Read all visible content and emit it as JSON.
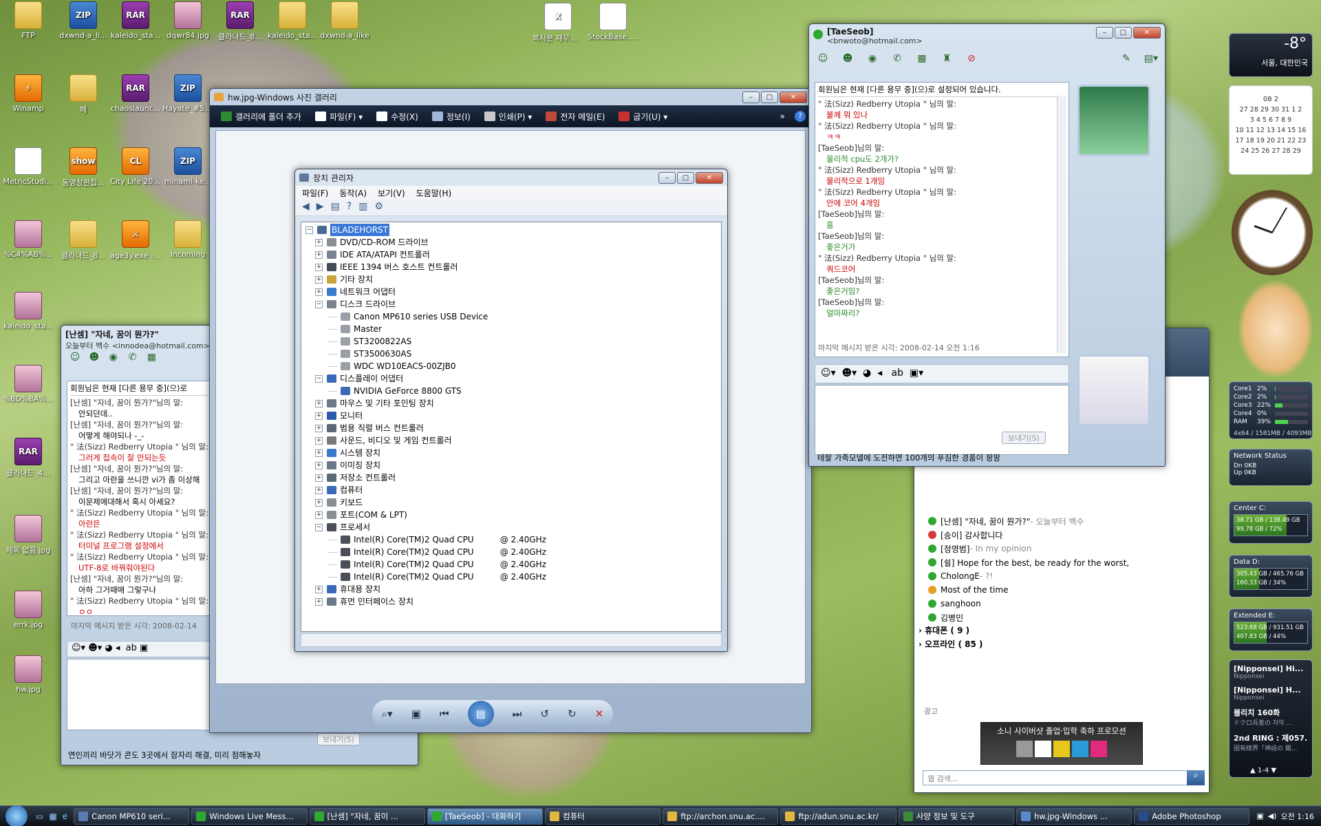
{
  "desktop_icons": [
    {
      "label": "FTP",
      "kind": "folder",
      "badge": ""
    },
    {
      "label": "dxwnd-a_li...",
      "kind": "zip",
      "badge": "ZIP"
    },
    {
      "label": "kaleido_sta...",
      "kind": "rar",
      "badge": "RAR"
    },
    {
      "label": "dqwr84.jpg",
      "kind": "img",
      "badge": ""
    },
    {
      "label": "클라나드_8...",
      "kind": "rar",
      "badge": "RAR"
    },
    {
      "label": "kaleido_sta...",
      "kind": "folder",
      "badge": ""
    },
    {
      "label": "dxwnd-a_like",
      "kind": "folder",
      "badge": ""
    },
    {
      "label": "복사본 재무제...",
      "kind": "doc",
      "badge": "X"
    },
    {
      "label": "StockBase.zip",
      "kind": "doc",
      "badge": ""
    },
    {
      "label": "Winamp",
      "kind": "app",
      "badge": "⚡"
    },
    {
      "label": "메",
      "kind": "folder",
      "badge": ""
    },
    {
      "label": "chaoslaunc...",
      "kind": "rar",
      "badge": "RAR"
    },
    {
      "label": "Hayate_#5_...",
      "kind": "zip",
      "badge": "ZIP"
    },
    {
      "label": "MetricStudi...",
      "kind": "doc",
      "badge": ""
    },
    {
      "label": "동영상편집...",
      "kind": "app",
      "badge": "show"
    },
    {
      "label": "City Life 2008",
      "kind": "app",
      "badge": "CL"
    },
    {
      "label": "minami-ke...",
      "kind": "zip",
      "badge": "ZIP"
    },
    {
      "label": "%C4%AB%...",
      "kind": "img",
      "badge": ""
    },
    {
      "label": "클라나드_8...",
      "kind": "folder",
      "badge": ""
    },
    {
      "label": "age3y.exe - 바로 가기",
      "kind": "app",
      "badge": "⚔"
    },
    {
      "label": "Incoming",
      "kind": "folder",
      "badge": ""
    },
    {
      "label": "kaleido_sta...",
      "kind": "img",
      "badge": ""
    },
    {
      "label": "%BD%BA%...",
      "kind": "img",
      "badge": ""
    },
    {
      "label": "클라나드_4...",
      "kind": "rar",
      "badge": "RAR"
    },
    {
      "label": "제목 없음.jpg",
      "kind": "img",
      "badge": ""
    },
    {
      "label": "errk.jpg",
      "kind": "img",
      "badge": ""
    },
    {
      "label": "hw.jpg",
      "kind": "img",
      "badge": ""
    }
  ],
  "msgr_main": {
    "title": "[TaeSeob]",
    "email": "<bnwoto@hotmail.com>",
    "status_notice": "회원님은 현재 [다른 용무 중](으)로 설정되어 있습니다.",
    "conversation": [
      {
        "who": "\" 法(Sizz) Redberry Utopia \" 님의 말:",
        "text": "볼께 뭐 있나",
        "c": "t1"
      },
      {
        "who": "\" 法(Sizz) Redberry Utopia \" 님의 말:",
        "text": "ㅋㅋ",
        "c": "t1"
      },
      {
        "who": "[TaeSeob]님의 말:",
        "text": "물리적 cpu도 2개가?",
        "c": "t2"
      },
      {
        "who": "\" 法(Sizz) Redberry Utopia \" 님의 말:",
        "text": "물리적으로 1개임",
        "c": "t1"
      },
      {
        "who": "\" 法(Sizz) Redberry Utopia \" 님의 말:",
        "text": "안에 코어 4개임",
        "c": "t1"
      },
      {
        "who": "[TaeSeob]님의 말:",
        "text": "흠",
        "c": "t2"
      },
      {
        "who": "[TaeSeob]님의 말:",
        "text": "좋은거가",
        "c": "t2"
      },
      {
        "who": "\" 法(Sizz) Redberry Utopia \" 님의 말:",
        "text": "쿼드코어",
        "c": "t1"
      },
      {
        "who": "[TaeSeob]님의 말:",
        "text": "좋은거임?",
        "c": "t2"
      },
      {
        "who": "[TaeSeob]님의 말:",
        "text": "얼마짜리?",
        "c": "t2"
      }
    ],
    "last_received": "마지막 메시지 받은 시각: 2008-02-14 오전 1:16",
    "send_label": "보내기(S)",
    "ad": "테팔 가족모델에 도전하면 100개의 푸짐한 경품이 팡팡"
  },
  "msgr_left": {
    "title": "[난셈] \"자네, 꿈이 뭔가?\"",
    "email": "오늘부터 백수 <innodea@hotmail.com>",
    "status_notice": "회원님은 현재 [다른 용무 중](으)로",
    "conversation": [
      {
        "who": "[난셈] \"자네, 꿈이 뭔가?\"님의 말:",
        "text": "안되던데..",
        "c": "t3"
      },
      {
        "who": "[난셈] \"자네, 꿈이 뭔가?\"님의 말:",
        "text": "어떻게 해야되나 -_-",
        "c": "t3"
      },
      {
        "who": "\" 法(Sizz) Redberry Utopia \" 님의 말:",
        "text": "그러게 접속이 잘 안되는듯",
        "c": "t1"
      },
      {
        "who": "[난셈] \"자네, 꿈이 뭔가?\"님의 말:",
        "text": "그리고 아란을 쓰니깐 vi가 좀 이상해",
        "c": "t3"
      },
      {
        "who": "[난셈] \"자네, 꿈이 뭔가?\"님의 말:",
        "text": "이문제에대해서 혹시 아세요?",
        "c": "t3"
      },
      {
        "who": "\" 法(Sizz) Redberry Utopia \" 님의 말:",
        "text": "아란은",
        "c": "t1"
      },
      {
        "who": "\" 法(Sizz) Redberry Utopia \" 님의 말:",
        "text": "터미널 프로그램 설정에서",
        "c": "t1"
      },
      {
        "who": "\" 法(Sizz) Redberry Utopia \" 님의 말:",
        "text": "UTF-8로 바꿔줘야된다",
        "c": "t1"
      },
      {
        "who": "[난셈] \"자네, 꿈이 뭔가?\"님의 말:",
        "text": "아하 그거때매 그렇구나",
        "c": "t3"
      },
      {
        "who": "\" 法(Sizz) Redberry Utopia \" 님의 말:",
        "text": "ㅇㅇ",
        "c": "t1"
      }
    ],
    "last_received": "마지막 메시지 받은 시각: 2008-02-14",
    "send_label": "보내기(S)",
    "ad": "연인끼리 바닷가 콘도 3곳에서 잠자리 해결, 미리 점해놓자"
  },
  "gallery": {
    "title": "hw.jpg-Windows 사진 갤러리",
    "toolbar": [
      "갤러리에 폴더 추가",
      "파일(F)",
      "수정(X)",
      "정보(I)",
      "인쇄(P)",
      "전자 메일(E)",
      "굽기(U)"
    ]
  },
  "devmgr": {
    "title": "장치 관리자",
    "menu": [
      "파일(F)",
      "동작(A)",
      "보기(V)",
      "도움말(H)"
    ],
    "root": "BLADEHORST",
    "nodes": [
      {
        "label": "DVD/CD-ROM 드라이브",
        "level": 1,
        "exp": "+",
        "ic": "#8a8f96"
      },
      {
        "label": "IDE ATA/ATAPI 컨트롤러",
        "level": 1,
        "exp": "+",
        "ic": "#7a8494"
      },
      {
        "label": "IEEE 1394 버스 호스트 컨트롤러",
        "level": 1,
        "exp": "+",
        "ic": "#444c58"
      },
      {
        "label": "기타 장치",
        "level": 1,
        "exp": "+",
        "ic": "#c8a43a"
      },
      {
        "label": "네트워크 어댑터",
        "level": 1,
        "exp": "+",
        "ic": "#3a7ac8"
      },
      {
        "label": "디스크 드라이브",
        "level": 1,
        "exp": "−",
        "ic": "#7c8490"
      },
      {
        "label": "Canon MP610 series USB Device",
        "level": 2,
        "exp": "",
        "ic": "#9aa0a8"
      },
      {
        "label": "Master",
        "level": 2,
        "exp": "",
        "ic": "#9aa0a8"
      },
      {
        "label": "ST3200822AS",
        "level": 2,
        "exp": "",
        "ic": "#9aa0a8"
      },
      {
        "label": "ST3500630AS",
        "level": 2,
        "exp": "",
        "ic": "#9aa0a8"
      },
      {
        "label": "WDC WD10EACS-00ZJB0",
        "level": 2,
        "exp": "",
        "ic": "#9aa0a8"
      },
      {
        "label": "디스플레이 어댑터",
        "level": 1,
        "exp": "−",
        "ic": "#3a6ab8"
      },
      {
        "label": "NVIDIA GeForce 8800 GTS",
        "level": 2,
        "exp": "",
        "ic": "#3a6ab8"
      },
      {
        "label": "마우스 및 기타 포인팅 장치",
        "level": 1,
        "exp": "+",
        "ic": "#6a7888"
      },
      {
        "label": "모니터",
        "level": 1,
        "exp": "+",
        "ic": "#2a5ab0"
      },
      {
        "label": "범용 직렬 버스 컨트롤러",
        "level": 1,
        "exp": "+",
        "ic": "#5a6878"
      },
      {
        "label": "사운드, 비디오 및 게임 컨트롤러",
        "level": 1,
        "exp": "+",
        "ic": "#7a7a7a"
      },
      {
        "label": "시스템 장치",
        "level": 1,
        "exp": "+",
        "ic": "#3a7ac8"
      },
      {
        "label": "이미징 장치",
        "level": 1,
        "exp": "+",
        "ic": "#6a7888"
      },
      {
        "label": "저장소 컨트롤러",
        "level": 1,
        "exp": "+",
        "ic": "#5a6878"
      },
      {
        "label": "컴퓨터",
        "level": 1,
        "exp": "+",
        "ic": "#3a6ab8"
      },
      {
        "label": "키보드",
        "level": 1,
        "exp": "+",
        "ic": "#8a8f96"
      },
      {
        "label": "포트(COM & LPT)",
        "level": 1,
        "exp": "+",
        "ic": "#8a8f96"
      },
      {
        "label": "프로세서",
        "level": 1,
        "exp": "−",
        "ic": "#4a4f58"
      },
      {
        "label": "Intel(R) Core(TM)2 Quad CPU          @ 2.40GHz",
        "level": 2,
        "exp": "",
        "ic": "#4a4f58"
      },
      {
        "label": "Intel(R) Core(TM)2 Quad CPU          @ 2.40GHz",
        "level": 2,
        "exp": "",
        "ic": "#4a4f58"
      },
      {
        "label": "Intel(R) Core(TM)2 Quad CPU          @ 2.40GHz",
        "level": 2,
        "exp": "",
        "ic": "#4a4f58"
      },
      {
        "label": "Intel(R) Core(TM)2 Quad CPU          @ 2.40GHz",
        "level": 2,
        "exp": "",
        "ic": "#4a4f58"
      },
      {
        "label": "휴대용 장치",
        "level": 1,
        "exp": "+",
        "ic": "#3a6ab8"
      },
      {
        "label": "휴먼 인터페이스 장치",
        "level": 1,
        "exp": "+",
        "ic": "#6a7888"
      }
    ]
  },
  "contacts": {
    "items": [
      {
        "label": "[난셈] \"자네, 꿈이 뭔가?\"",
        "sub": " - 오늘부터 백수",
        "status": "#2fa82f"
      },
      {
        "label": "[송이] 감사합니다",
        "sub": "",
        "status": "#d03a3a"
      },
      {
        "label": "[정영범]",
        "sub": " - In my opinion",
        "status": "#2fa82f"
      },
      {
        "label": "[쉴] Hope for the best, be ready for the worst,",
        "sub": "",
        "status": "#2fa82f"
      },
      {
        "label": "CholongE",
        "sub": " - ?!",
        "status": "#2fa82f"
      },
      {
        "label": "Most of the time",
        "sub": "",
        "status": "#e6a020"
      },
      {
        "label": "sanghoon",
        "sub": "",
        "status": "#2fa82f"
      },
      {
        "label": "김병민",
        "sub": "",
        "status": "#2fa82f"
      }
    ],
    "groups": [
      "휴대폰 ( 9 )",
      "오프라인 ( 85 )"
    ],
    "ad_label": "광고",
    "banner": "소니 사이버샷 졸업·입학 축하 프로모션",
    "search_placeholder": "웹 검색..."
  },
  "gadgets": {
    "weather_temp": "-8°",
    "weather_city": "서울, 대한민국",
    "calendar_title": "08 2",
    "calendar_rows": [
      "27 28 29 30 31 1 2",
      "3 4 5 6 7 8 9",
      "10 11 12 13 14 15 16",
      "17 18 19 20 21 22 23",
      "24 25 26 27 28 29"
    ],
    "cpu": [
      {
        "name": "Core1",
        "val": "2%",
        "fill": 0.02
      },
      {
        "name": "Core2",
        "val": "2%",
        "fill": 0.02
      },
      {
        "name": "Core3",
        "val": "22%",
        "fill": 0.22
      },
      {
        "name": "Core4",
        "val": "0%",
        "fill": 0
      },
      {
        "name": "RAM",
        "val": "39%",
        "fill": 0.39
      }
    ],
    "ram_detail": "4x64 / 1581MB / 4093MB",
    "network_title": "Network Status",
    "net_dn": "Dn  0KB",
    "net_up": "Up  0KB",
    "drives": [
      {
        "name": "Center C:",
        "a": "38.71 GB / 138.49 GB",
        "b": "99.78 GB / 72%",
        "fill": 0.72
      },
      {
        "name": "Data D:",
        "a": "305.43 GB / 465.76 GB",
        "b": "160.33 GB / 34%",
        "fill": 0.34
      },
      {
        "name": "Extended E:",
        "a": "523.68 GB / 931.51 GB",
        "b": "407.83 GB / 44%",
        "fill": 0.44
      }
    ],
    "feed": [
      {
        "t": "[Nipponsei] Hi...",
        "s": "Nipponsei"
      },
      {
        "t": "[Nipponsei] H...",
        "s": "Nipponsei"
      },
      {
        "t": "블리치 160화",
        "s": "ドクロ兵差の 자막 ..."
      },
      {
        "t": "2nd RING : 제057...",
        "s": "固有緯界「神話の 銀..."
      }
    ],
    "feed_page": "1-4"
  },
  "taskbar": {
    "items": [
      "Canon MP610 seri...",
      "Windows Live Mess...",
      "[난셈] \"자네, 꿈이 ...",
      "[TaeSeob] - 대화하기",
      "컴퓨터",
      "ftp://archon.snu.ac....",
      "ftp://adun.snu.ac.kr/",
      "사양 정보 및 도구",
      "hw.jpg-Windows ...",
      "Adobe Photoshop"
    ],
    "clock": "오전 1:16"
  }
}
